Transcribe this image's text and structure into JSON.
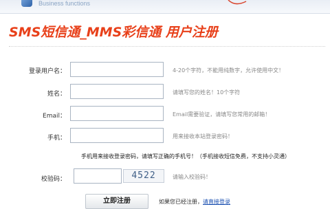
{
  "header": {
    "subtitle": "Business functions"
  },
  "title": "SMS短信通_MMS彩信通 用户注册",
  "form": {
    "fields": [
      {
        "label": "登录用户名：",
        "hint": "4-20个字符，不能用纯数字，允许使用中文！"
      },
      {
        "label": "姓名：",
        "hint": "请填写您的姓名！10个字符"
      },
      {
        "label": "Email：",
        "hint": "Email需要验证，请填写您常用的邮箱！"
      },
      {
        "label": "手机：",
        "hint": "用来接收本站登录密码！"
      }
    ],
    "notice": "手机用来接收登录密码，请填写正确的手机号！（手机接收短信免费，不支持小灵通）",
    "captcha": {
      "label": "校验码：",
      "code": "4522",
      "hint": "请输入校验码！"
    },
    "submit_label": "立即注册",
    "login_prompt": "如果您已经注册，",
    "login_link": "请直接登录"
  },
  "colors": {
    "title": "#e8401a",
    "link": "#1a4fb0"
  }
}
